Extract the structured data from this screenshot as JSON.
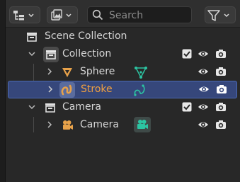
{
  "toolbar": {
    "display_mode_icon": "outliner-display-icon",
    "filter_view_icon": "image-view-icon",
    "search": {
      "placeholder": "Search",
      "value": ""
    },
    "filter_icon": "funnel-icon"
  },
  "outliner": {
    "scene_collection": {
      "label": "Scene Collection",
      "icon": "scene-collection-icon"
    },
    "collection": {
      "label": "Collection",
      "icon": "collection-icon",
      "visible_checked": true
    },
    "sphere": {
      "label": "Sphere",
      "icon": "mesh-object-icon",
      "data_icon": "mesh-data-icon",
      "color": "#e8a24a"
    },
    "stroke": {
      "label": "Stroke",
      "icon": "grease-pencil-icon",
      "data_icon": "stroke-data-icon",
      "selected": true,
      "label_color": "#f0a040"
    },
    "camera_collection": {
      "label": "Camera",
      "icon": "collection-icon",
      "visible_checked": true
    },
    "camera": {
      "label": "Camera",
      "icon": "camera-object-icon",
      "data_icon": "camera-data-icon"
    }
  },
  "colors": {
    "accent_selected": "#36477b",
    "object_orange": "#e8a24a",
    "data_teal": "#2cc4a2"
  }
}
